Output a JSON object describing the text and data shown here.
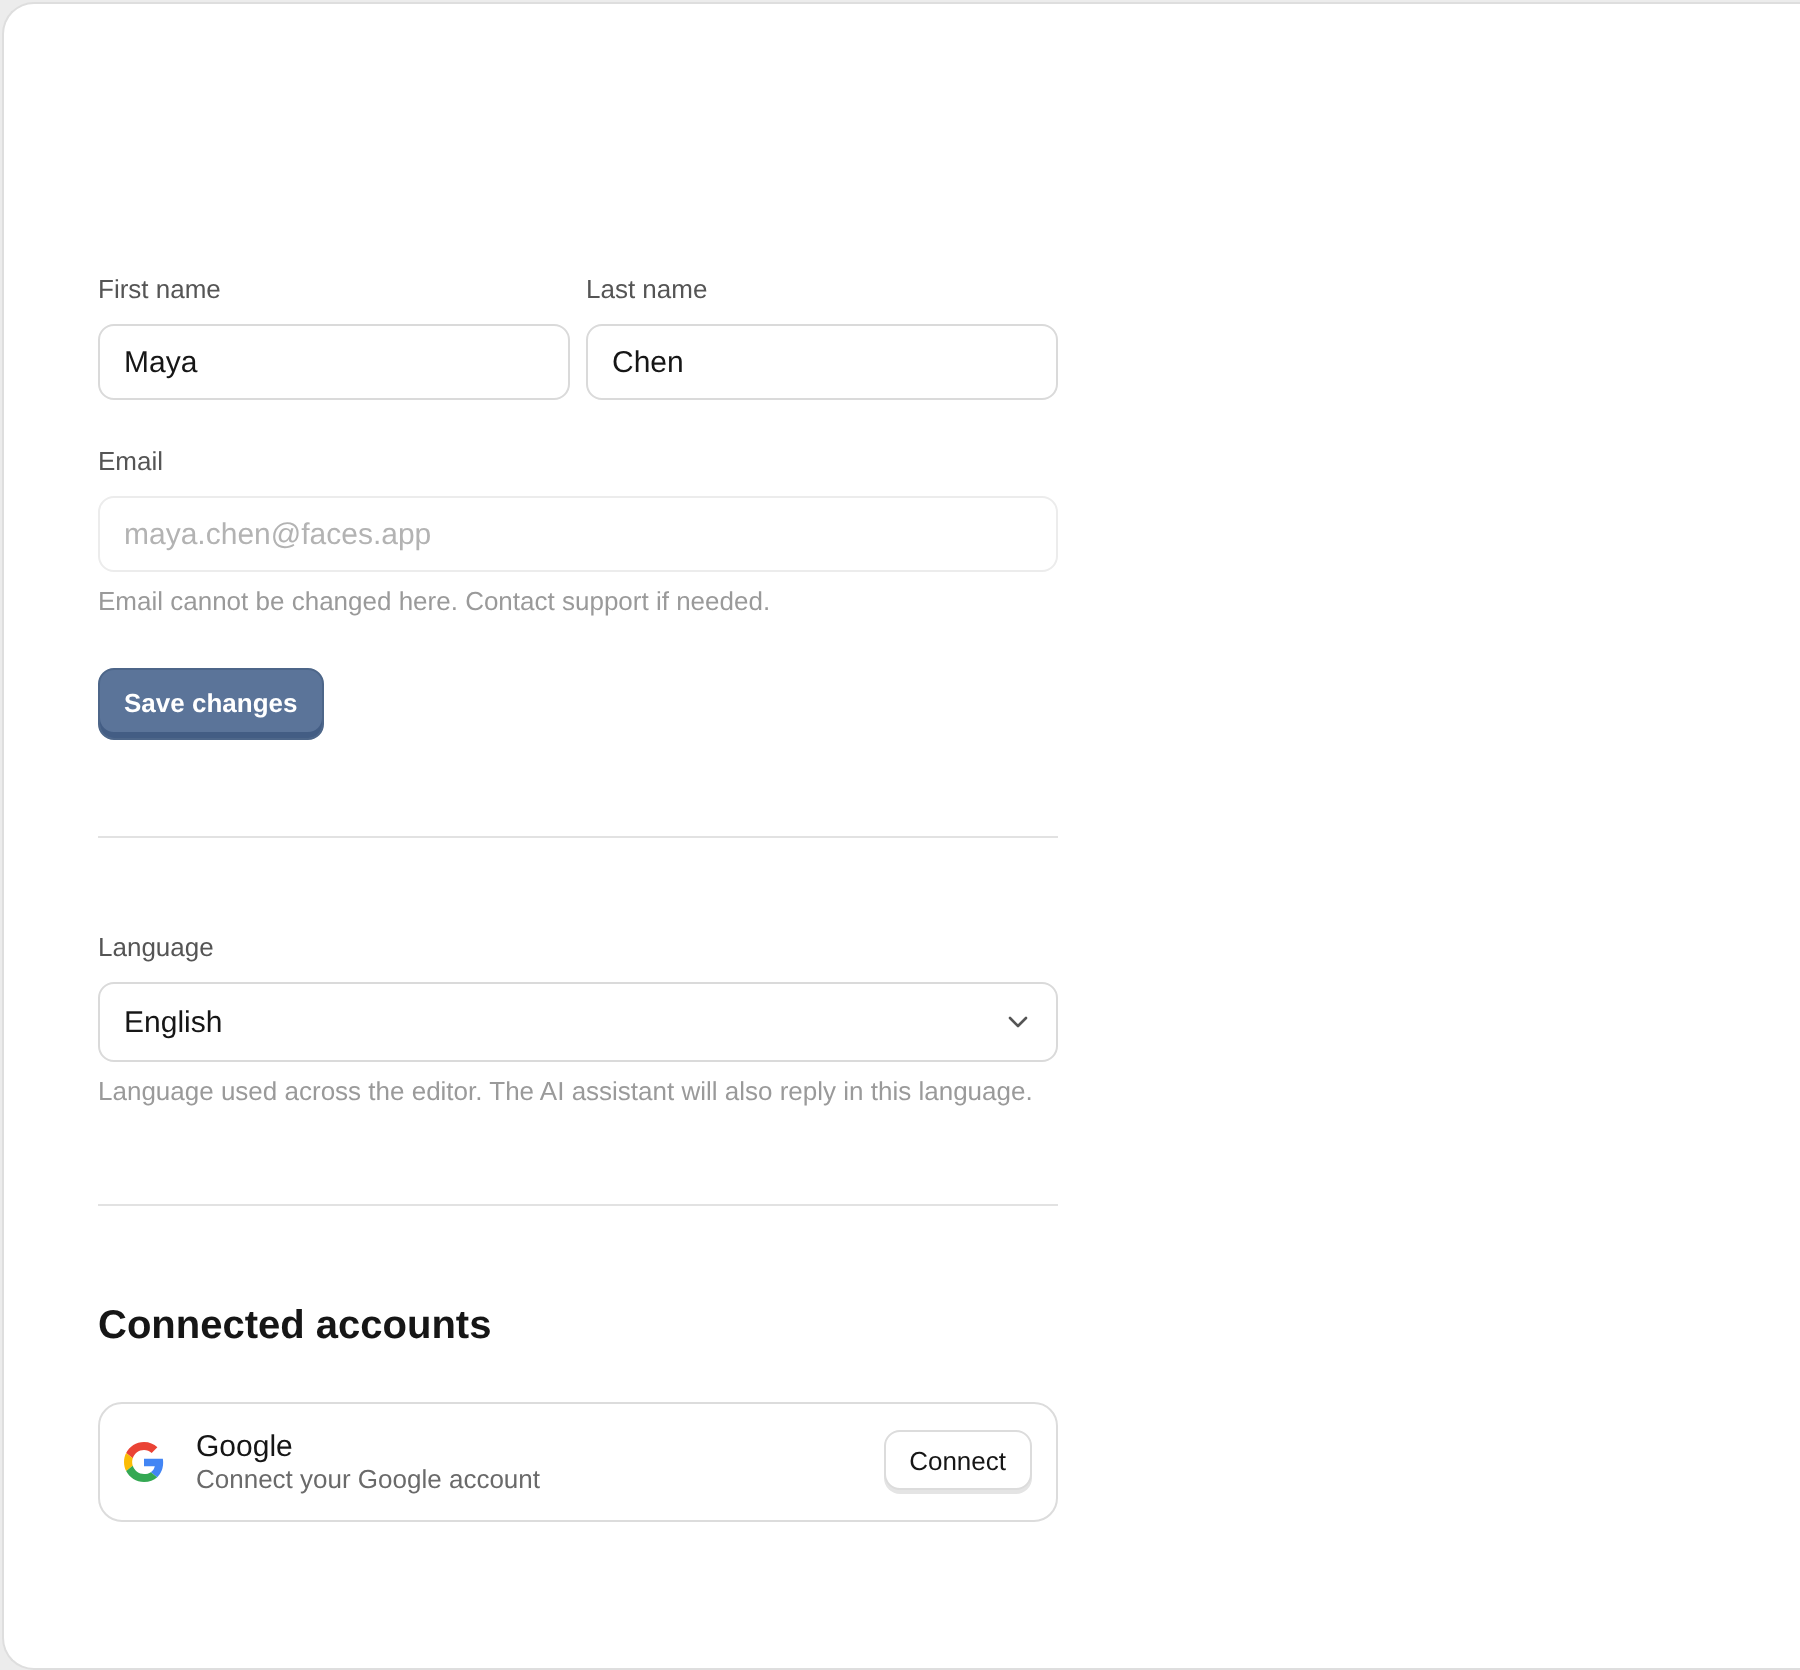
{
  "name_fields": [
    {
      "label": "First name",
      "value": "Maya"
    },
    {
      "label": "Last name",
      "value": "Chen"
    }
  ],
  "email_field": {
    "label": "Email",
    "value": "maya.chen@faces.app",
    "disabled": true,
    "hint": "Email cannot be changed here. Contact support if needed."
  },
  "save_button": {
    "label": "Save changes"
  },
  "language_field": {
    "label": "Language",
    "value": "English",
    "hint": "Language used across the editor. The AI assistant will also reply in this language."
  },
  "connected_accounts": {
    "title": "Connected accounts",
    "accounts": [
      {
        "name": "Google",
        "description": "Connect your Google account",
        "action": "Connect"
      }
    ]
  }
}
